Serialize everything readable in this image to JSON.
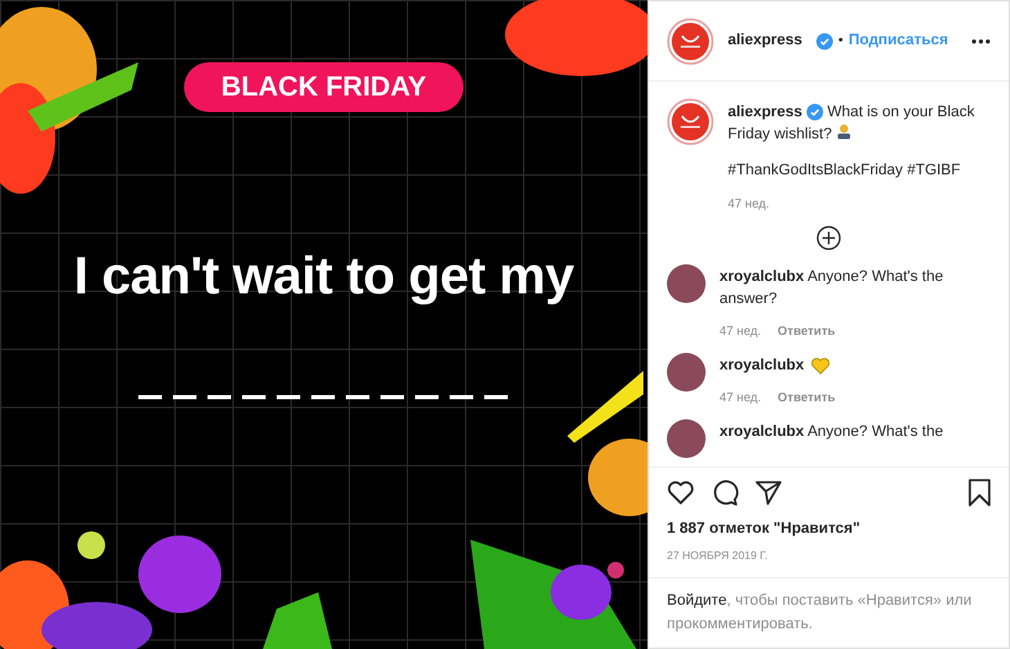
{
  "post_image": {
    "badge": "BLACK FRIDAY",
    "headline": "I can't wait to get my"
  },
  "header": {
    "username": "aliexpress",
    "verified": true,
    "separator": "•",
    "follow": "Подписаться"
  },
  "caption": {
    "username": "aliexpress",
    "verified": true,
    "text": "What is on your Black Friday wishlist?",
    "hashtags": "#ThankGodItsBlackFriday #TGIBF",
    "time": "47 нед."
  },
  "comments": [
    {
      "kind": "text",
      "username": "xroyalclubx",
      "text": "Anyone? What's the answer?",
      "time": "47 нед.",
      "reply": "Ответить"
    },
    {
      "kind": "emoji",
      "username": "xroyalclubx",
      "time": "47 нед.",
      "reply": "Ответить"
    },
    {
      "kind": "text",
      "username": "xroyalclubx",
      "text": "Anyone? What's the"
    }
  ],
  "likes": "1 887 отметок \"Нравится\"",
  "date": "27 НОЯБРЯ 2019 Г.",
  "login": {
    "link": "Войдите",
    "text": ", чтобы поставить «Нравится» или прокомментировать."
  }
}
